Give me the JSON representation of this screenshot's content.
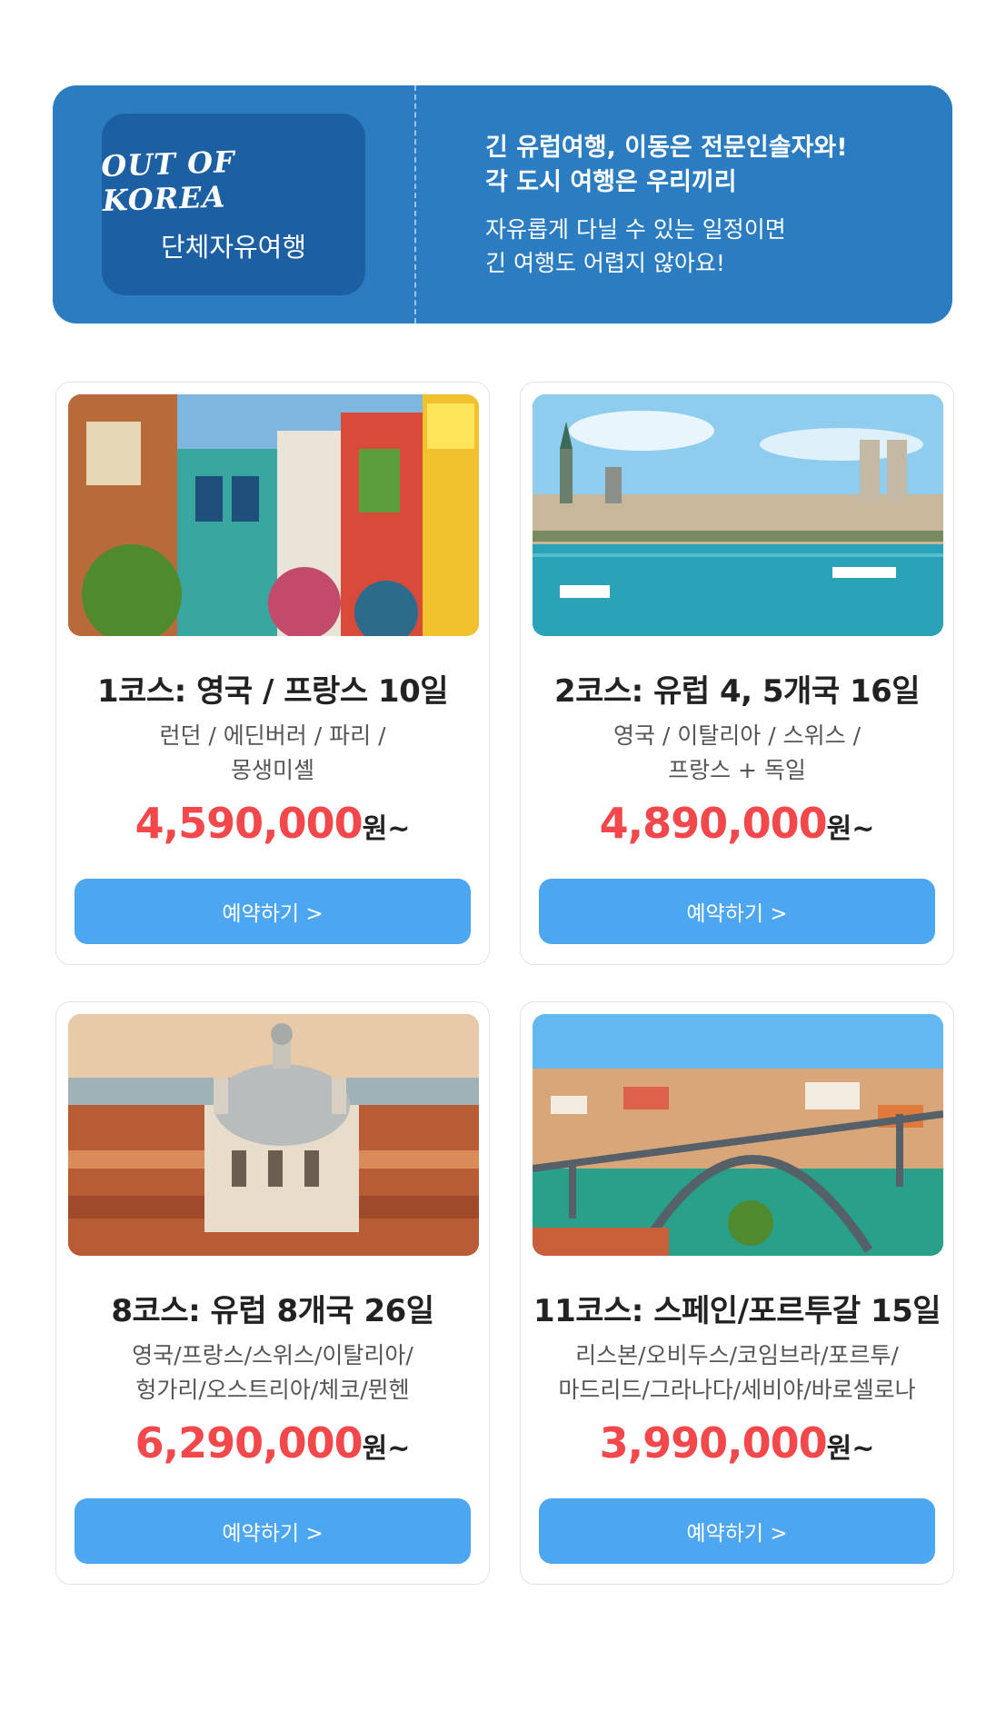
{
  "banner": {
    "logo": "OUT OF KOREA",
    "logo_sub": "단체자유여행",
    "headline_1": "긴 유럽여행, 이동은 전문인솔자와!",
    "headline_2": "각 도시 여행은 우리끼리",
    "body_1": "자유롭게 다닐 수 있는 일정이면",
    "body_2": "긴 여행도 어렵지 않아요!"
  },
  "courses": [
    {
      "title": "1코스: 영국 / 프랑스 10일",
      "desc_1": "런던 / 에딘버러 / 파리 /",
      "desc_2": "몽생미셸",
      "price": "4,590,000",
      "price_unit": "원~",
      "button": "예약하기 >",
      "photo": "colorful-street-photo"
    },
    {
      "title": "2코스: 유럽 4, 5개국 16일",
      "desc_1": "영국 / 이탈리아 / 스위스 /",
      "desc_2": "프랑스 + 독일",
      "price": "4,890,000",
      "price_unit": "원~",
      "button": "예약하기 >",
      "photo": "zurich-river-photo"
    },
    {
      "title": "8코스: 유럽 8개국 26일",
      "desc_1": "영국/프랑스/스위스/이탈리아/",
      "desc_2": "헝가리/오스트리아/체코/뮌헨",
      "price": "6,290,000",
      "price_unit": "원~",
      "button": "예약하기 >",
      "photo": "venice-basilica-photo"
    },
    {
      "title": "11코스: 스페인/포르투갈 15일",
      "desc_1": "리스본/오비두스/코임브라/포르투/",
      "desc_2": "마드리드/그라나다/세비야/바로셀로나",
      "price": "3,990,000",
      "price_unit": "원~",
      "button": "예약하기 >",
      "photo": "porto-bridge-photo"
    }
  ],
  "colors": {
    "banner_bg": "#2b7cc0",
    "logo_box": "#1d5fa3",
    "price": "#f2474b",
    "button": "#4ca6f0"
  }
}
